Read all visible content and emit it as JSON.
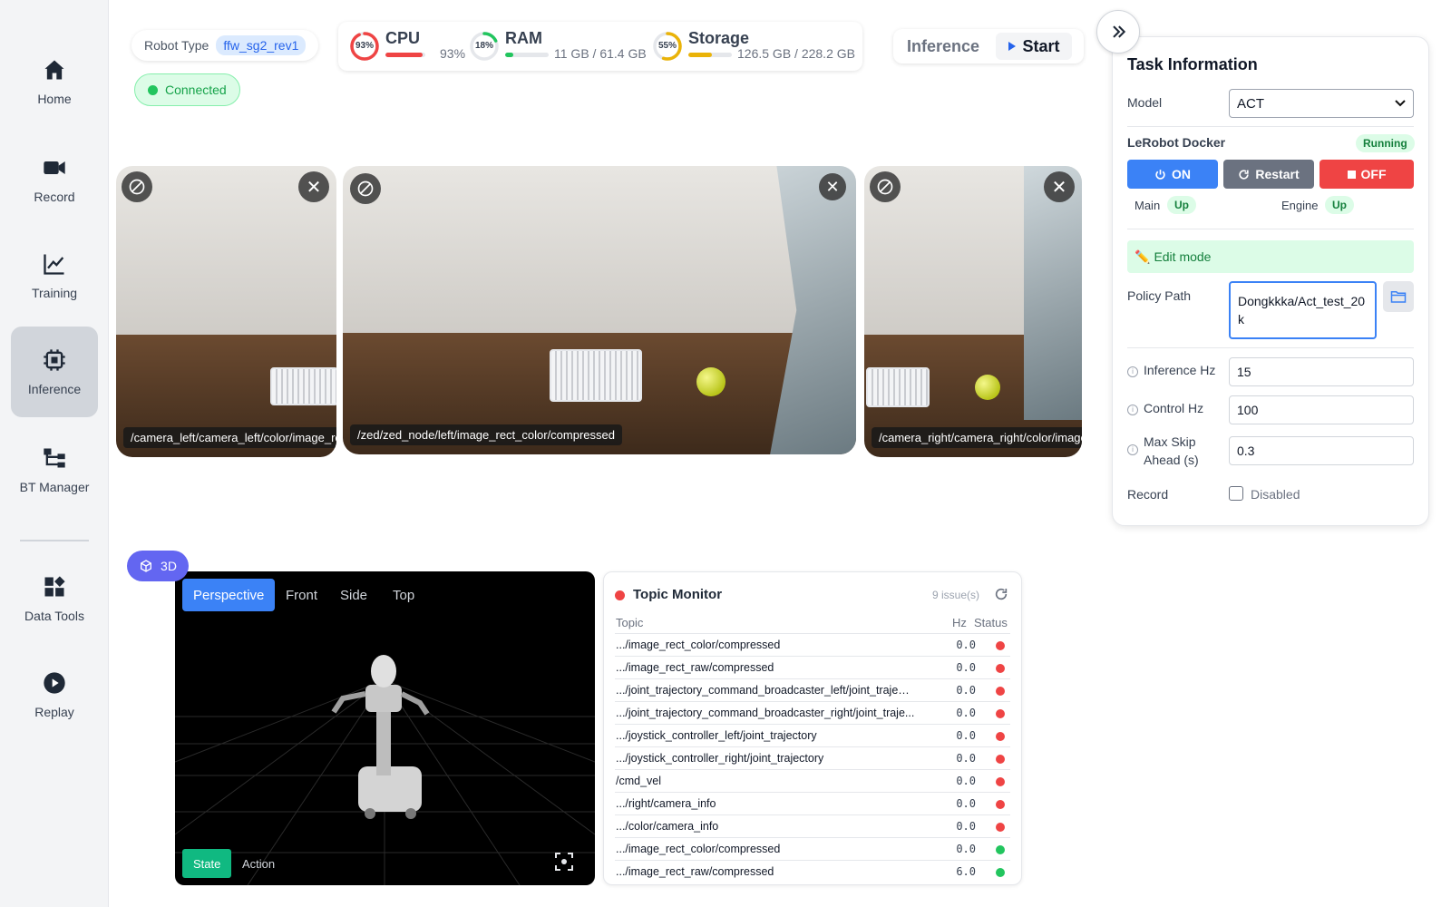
{
  "sidebar": {
    "items": [
      {
        "label": "Home",
        "icon": "home-icon"
      },
      {
        "label": "Record",
        "icon": "video-icon"
      },
      {
        "label": "Training",
        "icon": "chart-line-icon"
      },
      {
        "label": "Inference",
        "icon": "cpu-icon",
        "active": true
      },
      {
        "label": "BT Manager",
        "icon": "tree-icon"
      },
      {
        "label": "Data Tools",
        "icon": "grid-icon"
      },
      {
        "label": "Replay",
        "icon": "play-icon"
      }
    ]
  },
  "header": {
    "robot_type_label": "Robot Type",
    "robot_type_value": "ffw_sg2_rev1",
    "connection_status": "Connected",
    "cpu": {
      "title": "CPU",
      "ring": "93%",
      "value": "93%",
      "percent": 93,
      "color": "#ef4444"
    },
    "ram": {
      "title": "RAM",
      "ring": "18%",
      "value": "11 GB / 61.4 GB",
      "percent": 18,
      "color": "#22c55e"
    },
    "storage": {
      "title": "Storage",
      "ring": "55%",
      "value": "126.5 GB / 228.2 GB",
      "percent": 55,
      "color": "#eab308"
    },
    "inference_label": "Inference",
    "start_label": "Start"
  },
  "cameras": [
    {
      "label": "/camera_left/camera_left/color/image_rect_raw/compressed"
    },
    {
      "label": "/zed/zed_node/left/image_rect_color/compressed"
    },
    {
      "label": "/camera_right/camera_right/color/image_rect_raw/compressed"
    }
  ],
  "viewer": {
    "badge": "3D",
    "tabs": [
      "Perspective",
      "Front",
      "Side",
      "Top"
    ],
    "modes": [
      "State",
      "Action"
    ]
  },
  "topic_monitor": {
    "title": "Topic Monitor",
    "issues": "9 issue(s)",
    "col_topic": "Topic",
    "col_hz": "Hz",
    "col_status": "Status",
    "rows": [
      {
        "topic": ".../image_rect_color/compressed",
        "hz": "0.0",
        "ok": false
      },
      {
        "topic": ".../image_rect_raw/compressed",
        "hz": "0.0",
        "ok": false
      },
      {
        "topic": ".../joint_trajectory_command_broadcaster_left/joint_traject...",
        "hz": "0.0",
        "ok": false
      },
      {
        "topic": ".../joint_trajectory_command_broadcaster_right/joint_traje...",
        "hz": "0.0",
        "ok": false
      },
      {
        "topic": ".../joystick_controller_left/joint_trajectory",
        "hz": "0.0",
        "ok": false
      },
      {
        "topic": ".../joystick_controller_right/joint_trajectory",
        "hz": "0.0",
        "ok": false
      },
      {
        "topic": "/cmd_vel",
        "hz": "0.0",
        "ok": false
      },
      {
        "topic": ".../right/camera_info",
        "hz": "0.0",
        "ok": false
      },
      {
        "topic": ".../color/camera_info",
        "hz": "0.0",
        "ok": false
      },
      {
        "topic": ".../image_rect_color/compressed",
        "hz": "0.0",
        "ok": true
      },
      {
        "topic": ".../image_rect_raw/compressed",
        "hz": "6.0",
        "ok": true
      }
    ]
  },
  "task_panel": {
    "title": "Task Information",
    "model_label": "Model",
    "model_value": "ACT",
    "docker_title": "LeRobot Docker",
    "docker_status": "Running",
    "on_label": "ON",
    "restart_label": "Restart",
    "off_label": "OFF",
    "main_label": "Main",
    "main_status": "Up",
    "engine_label": "Engine",
    "engine_status": "Up",
    "edit_mode": "Edit mode",
    "policy_label": "Policy Path",
    "policy_value": "Dongkkka/Act_test_20k",
    "inference_hz_label": "Inference Hz",
    "inference_hz": "15",
    "control_hz_label": "Control Hz",
    "control_hz": "100",
    "max_skip_label_1": "Max Skip",
    "max_skip_label_2": "Ahead (s)",
    "max_skip": "0.3",
    "record_label": "Record",
    "record_value": "Disabled"
  }
}
